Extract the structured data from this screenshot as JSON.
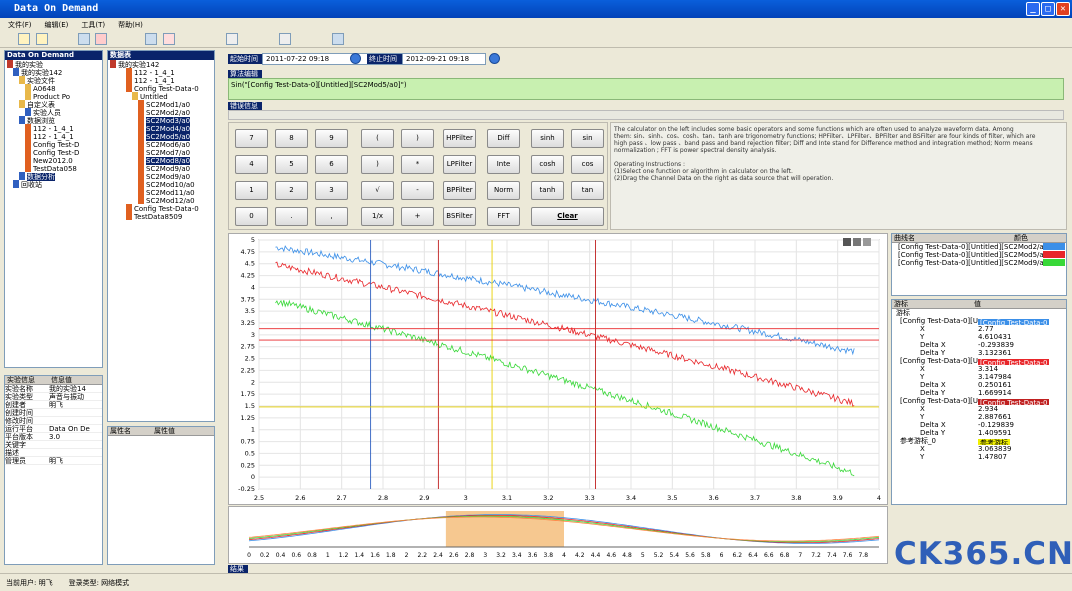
{
  "window": {
    "title": "Data On Demand",
    "min": "_",
    "max": "□",
    "close": "✕"
  },
  "menu": [
    "文件(F)",
    "编辑(E)",
    "工具(T)",
    "帮助(H)"
  ],
  "left_tree": {
    "header": "Data On Demand",
    "items": [
      "我的实验",
      "我的实验142",
      "实验文件",
      "A0648",
      "Product Po",
      "自定义表",
      "实验人员",
      "数据浏览",
      "112 - 1_4_1",
      "112 - 1_4_1",
      "Config Test-D",
      "Config Test-D",
      "New2012.0",
      "TestData058",
      "数据分析",
      "回收站"
    ]
  },
  "mid_tree": {
    "header": "数据表",
    "items": [
      "我的实验142",
      "112 - 1_4_1",
      "112 - 1_4_1",
      "Config Test-Data-0",
      "Untitled",
      "SC2Mod1/a0",
      "SC2Mod2/a0",
      "SC2Mod3/a0",
      "SC2Mod4/a0",
      "SC2Mod5/a0",
      "SC2Mod6/a0",
      "SC2Mod7/a0",
      "SC2Mod8/a0",
      "SC2Mod9/a0",
      "SC2Mod9/a0",
      "SC2Mod10/a0",
      "SC2Mod11/a0",
      "SC2Mod12/a0",
      "Config Test-Data-0",
      "TestData8509"
    ],
    "selected": [
      7,
      8,
      9,
      12
    ]
  },
  "info_panel": {
    "header_cols": [
      "实验信息",
      "信息值"
    ],
    "rows": [
      [
        "实验名称",
        "我的实验14"
      ],
      [
        "实验类型",
        "声音与振动"
      ],
      [
        "创建者",
        "明飞"
      ],
      [
        "创建时间",
        ""
      ],
      [
        "修改时间",
        ""
      ],
      [
        "运行平台",
        "Data On De"
      ],
      [
        "平台版本",
        "3.0"
      ],
      [
        "关键字",
        ""
      ],
      [
        "描述",
        ""
      ],
      [
        "管理员",
        "明飞"
      ]
    ]
  },
  "attr_panel": {
    "header_cols": [
      "属性名",
      "属性值"
    ]
  },
  "time": {
    "start_label": "起始时间",
    "start_value": "2011-07-22  09:18",
    "end_label": "终止时间",
    "end_value": "2012-09-21  09:18"
  },
  "formula": {
    "label": "算法编辑",
    "value": "Sin(\"[Config Test-Data-0][Untitled][SC2Mod5/a0]\")"
  },
  "error_label": "错误信息",
  "calc": {
    "keys": [
      [
        "7",
        "8",
        "9",
        "(",
        ")"
      ],
      [
        "4",
        "5",
        "6",
        ")",
        "*"
      ],
      [
        "1",
        "2",
        "3",
        "√",
        "-"
      ],
      [
        "0",
        ".",
        ",",
        "1/x",
        "+"
      ]
    ],
    "filters": [
      "HPFilter",
      "LPFilter",
      "BPFilter",
      "BSFilter"
    ],
    "ops": [
      "Diff",
      "Inte",
      "Norm",
      "FFT"
    ],
    "trig": [
      [
        "sinh",
        "sin"
      ],
      [
        "cosh",
        "cos"
      ],
      [
        "tanh",
        "tan"
      ]
    ],
    "clear": "Clear"
  },
  "help": {
    "lines": [
      "The calculator on the left includes some basic operators and some functions which are often used to analyze waveform data. Among",
      "them: sin、sinh、cos、cosh、tan、tanh are trigonometry functions; HPFilter、LPFilter、BPFilter and BSFilter are four kinds of filter, which are",
      "high pass 、low pass 、band pass and band rejection filter; Diff and Inte stand for Difference method and integration method; Norm means",
      "normalization ; FFT is power spectral density analysis.",
      "",
      "Operating Instructions :",
      "(1)Select one function or algorithm in calculator on the left.",
      "(2)Drag the Channel Data on the right as data source that will operation."
    ]
  },
  "legend": {
    "header_cols": [
      "曲线名",
      "颜色"
    ],
    "items": [
      {
        "name": "[Config Test-Data-0][Untitled][SC2Mod2/a0]",
        "color": "#3b8fe8"
      },
      {
        "name": "[Config Test-Data-0][Untitled][SC2Mod5/a0]",
        "color": "#e8262a"
      },
      {
        "name": "[Config Test-Data-0][Untitled][SC2Mod9/a0]",
        "color": "#38d838"
      }
    ]
  },
  "cursor_panel": {
    "header_cols": [
      "游标",
      "值"
    ],
    "root": "游标",
    "groups": [
      {
        "name": "[Config Test-Data-0][Ur",
        "tag": "[Config Test-Data-0",
        "color": "#3b8fe8",
        "vals": [
          [
            "X",
            "2.77"
          ],
          [
            "Y",
            "4.610431"
          ],
          [
            "Delta X",
            "-0.293839"
          ],
          [
            "Delta Y",
            "3.132361"
          ]
        ]
      },
      {
        "name": "[Config Test-Data-0][Ur",
        "tag": "[Config Test-Data-0",
        "color": "#e8262a",
        "vals": [
          [
            "X",
            "3.314"
          ],
          [
            "Y",
            "3.147984"
          ],
          [
            "Delta X",
            "0.250161"
          ],
          [
            "Delta Y",
            "1.669914"
          ]
        ]
      },
      {
        "name": "[Config Test-Data-0][Ur",
        "tag": "[Config Test-Data-0",
        "color": "#c02020",
        "vals": [
          [
            "X",
            "2.934"
          ],
          [
            "Y",
            "2.887661"
          ],
          [
            "Delta X",
            "-0.129839"
          ],
          [
            "Delta Y",
            "1.409591"
          ]
        ]
      },
      {
        "name": "参考游标_0",
        "tag": "参考游标",
        "color": "#f0f000",
        "vals": [
          [
            "X",
            "3.063839"
          ],
          [
            "Y",
            "1.47807"
          ]
        ]
      }
    ]
  },
  "chart_data": {
    "type": "line",
    "x_ticks": [
      "2.5",
      "2.6",
      "2.7",
      "2.8",
      "2.9",
      "3",
      "3.1",
      "3.2",
      "3.3",
      "3.4",
      "3.5",
      "3.6",
      "3.7",
      "3.8",
      "3.9",
      "4"
    ],
    "y_ticks": [
      "5",
      "4.75",
      "4.5",
      "4.25",
      "4",
      "3.75",
      "3.5",
      "3.25",
      "3",
      "2.75",
      "2.5",
      "2.25",
      "2",
      "1.75",
      "1.5",
      "1.25",
      "1",
      "0.75",
      "0.5",
      "0.25",
      "0",
      "-0.25"
    ],
    "xlim": [
      2.5,
      4.0
    ],
    "ylim": [
      -0.25,
      5.0
    ],
    "series": [
      {
        "start": [
          2.54,
          4.85
        ],
        "end": [
          3.94,
          2.65
        ],
        "color": "#3b8fe8",
        "noise": 0.07
      },
      {
        "start": [
          2.54,
          4.48
        ],
        "end": [
          3.94,
          1.55
        ],
        "color": "#e8262a",
        "noise": 0.07
      },
      {
        "start": [
          2.54,
          3.72
        ],
        "end": [
          3.94,
          0.08
        ],
        "color": "#38d838",
        "noise": 0.07
      }
    ],
    "v_cursors": [
      {
        "x": 2.77,
        "color": "#3060c0"
      },
      {
        "x": 2.934,
        "color": "#c02020"
      },
      {
        "x": 3.063839,
        "color": "#e8d000"
      },
      {
        "x": 3.314,
        "color": "#c02020"
      }
    ],
    "h_cursors": [
      {
        "y": 3.13,
        "color": "#e8262a"
      },
      {
        "y": 2.89,
        "color": "#e8262a"
      },
      {
        "y": 1.48,
        "color": "#e8d000"
      }
    ]
  },
  "overview": {
    "x_ticks": [
      "0",
      "0.2",
      "0.4",
      "0.6",
      "0.8",
      "1",
      "1.2",
      "1.4",
      "1.6",
      "1.8",
      "2",
      "2.2",
      "2.4",
      "2.6",
      "2.8",
      "3",
      "3.2",
      "3.4",
      "3.6",
      "3.8",
      "4",
      "4.2",
      "4.4",
      "4.6",
      "4.8",
      "5",
      "5.2",
      "5.4",
      "5.6",
      "5.8",
      "6",
      "6.2",
      "6.4",
      "6.6",
      "6.8",
      "7",
      "7.2",
      "7.4",
      "7.6",
      "7.8"
    ],
    "xlim": [
      0,
      8
    ],
    "selection": [
      2.5,
      4.0
    ]
  },
  "bottom_tab": "结果",
  "status": {
    "user": "当前用户: 明飞",
    "mode": "登录类型: 网络模式"
  },
  "watermark": "CK365.CN"
}
